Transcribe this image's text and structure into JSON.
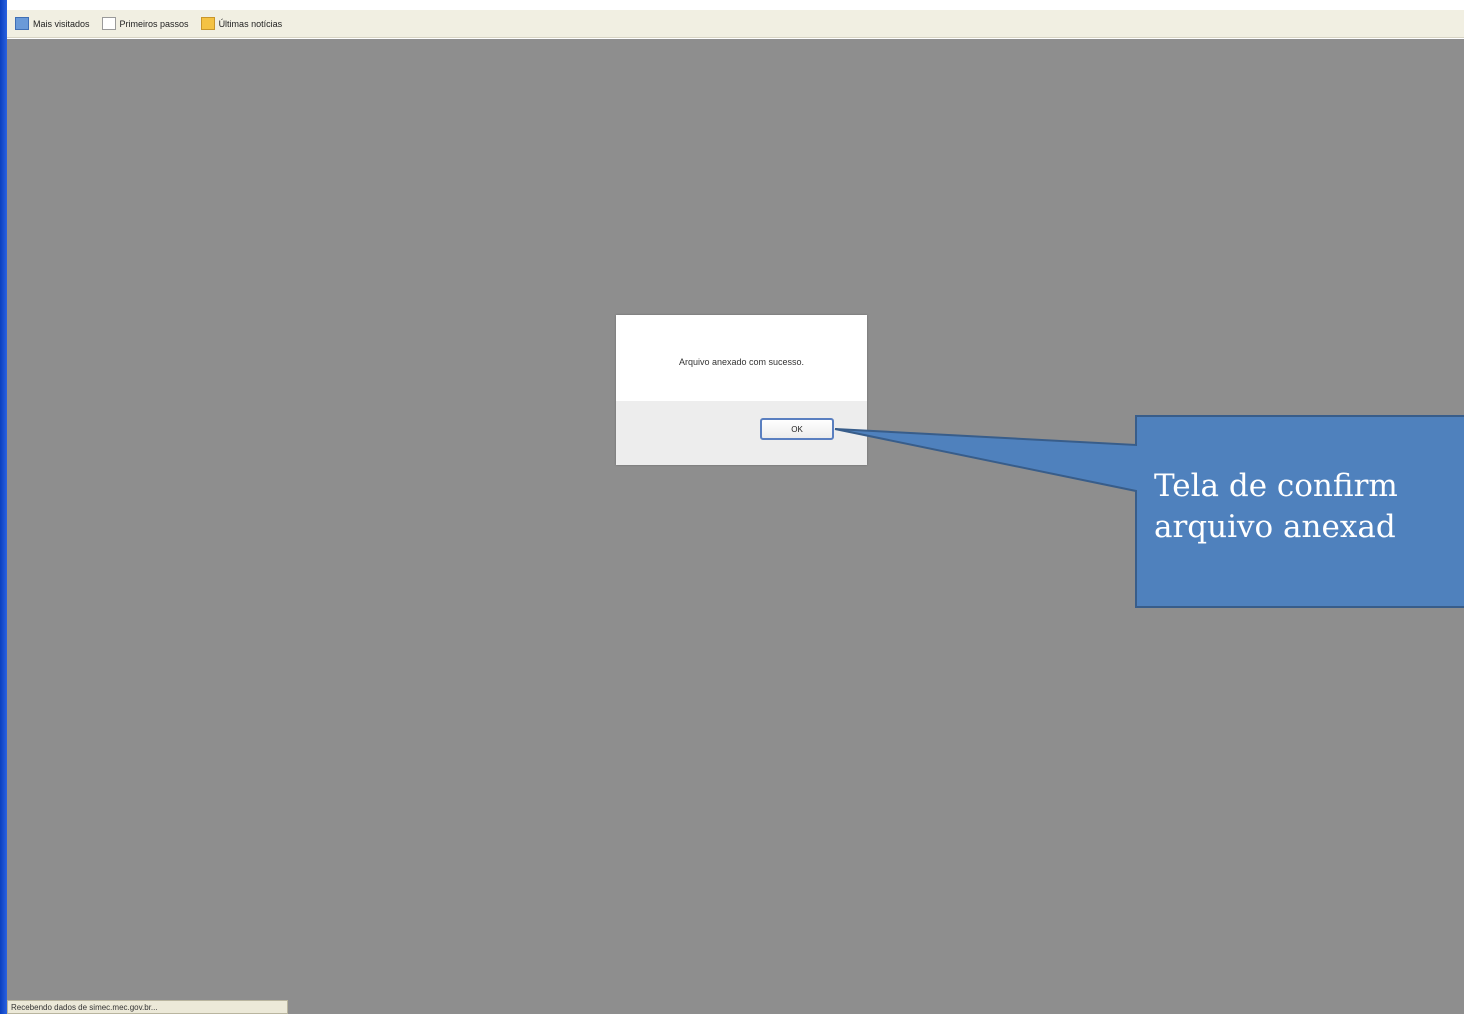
{
  "bookmarks": [
    {
      "label": "Mais visitados",
      "icon": "globe-icon"
    },
    {
      "label": "Primeiros passos",
      "icon": "page-icon"
    },
    {
      "label": "Últimas notícias",
      "icon": "feed-icon"
    }
  ],
  "dialog": {
    "message": "Arquivo anexado com sucesso.",
    "ok_label": "OK"
  },
  "callout": {
    "line1": "Tela de confirm",
    "line2": "arquivo anexad",
    "fill_color": "#4f81bd",
    "border_color": "#385d8a"
  },
  "status_bar": {
    "text": "Recebendo dados de simec.mec.gov.br..."
  },
  "colors": {
    "overlay": "#8e8e8e",
    "bookmarks_bar": "#f1efe2"
  }
}
